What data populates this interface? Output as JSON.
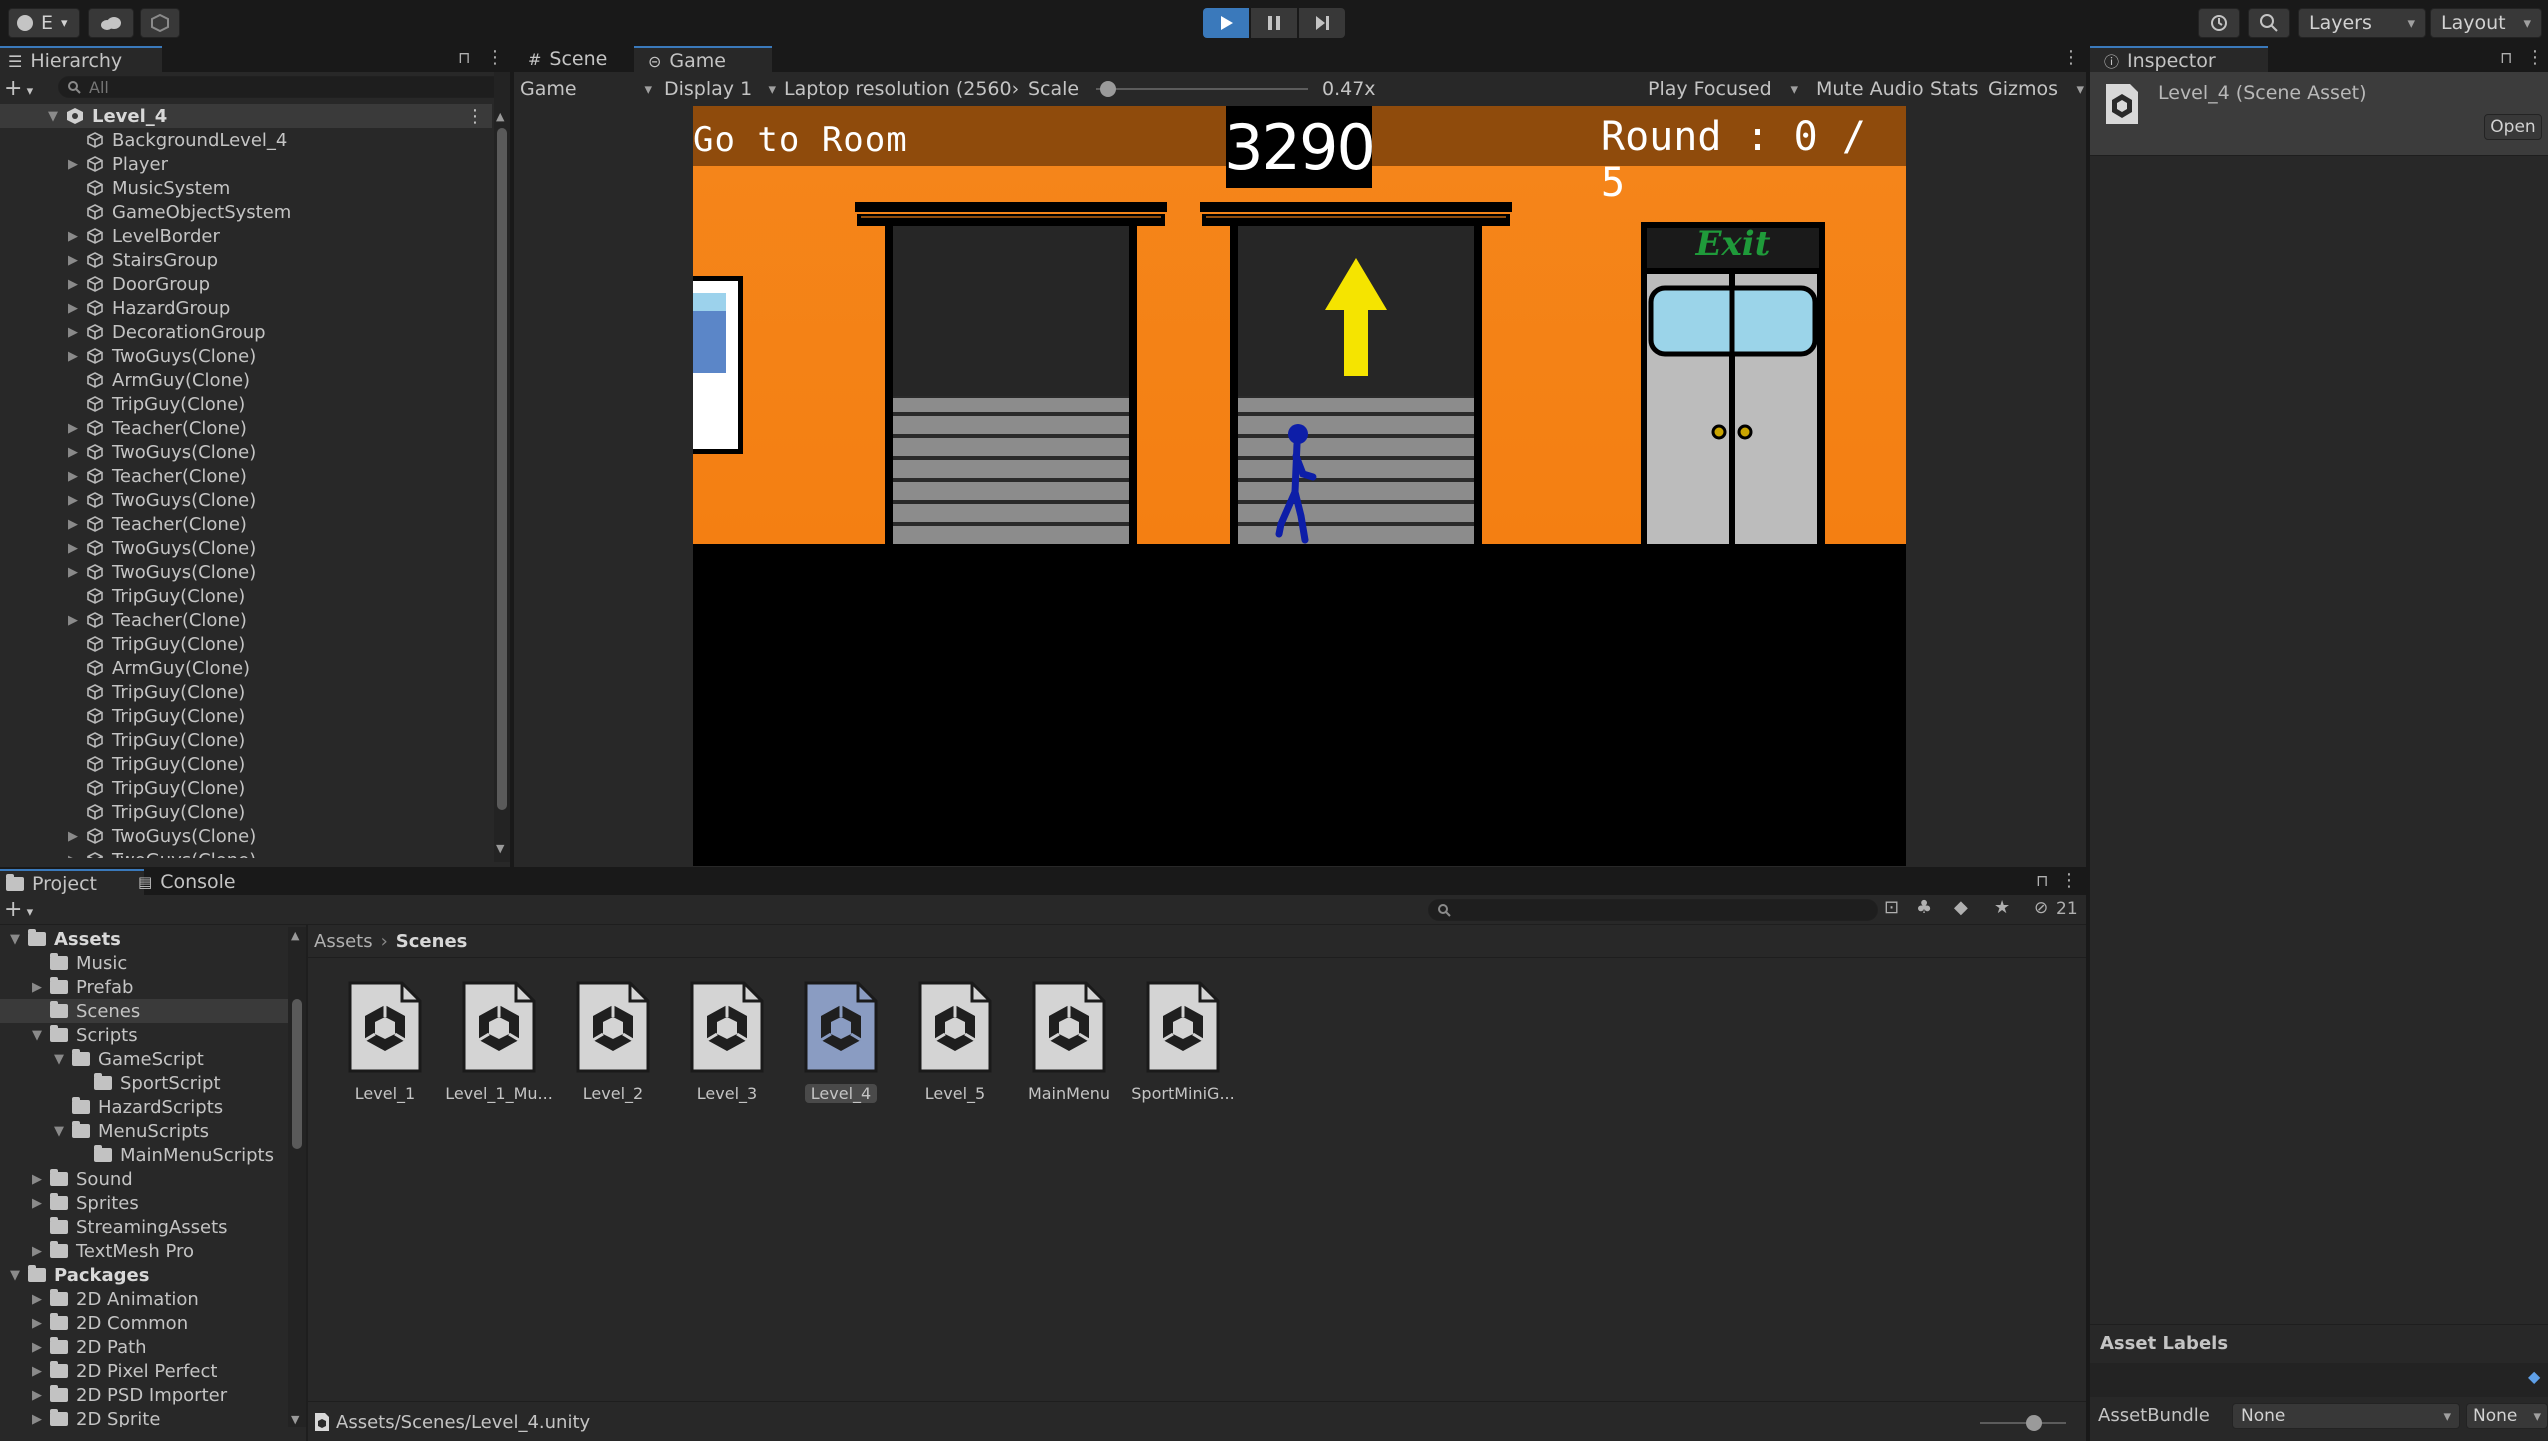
{
  "toolbar": {
    "account_label": "E",
    "layers_label": "Layers",
    "layout_label": "Layout"
  },
  "hierarchy": {
    "tab": "Hierarchy",
    "search_placeholder": "All",
    "scene_name": "Level_4",
    "items": [
      {
        "label": "BackgroundLevel_4",
        "expandable": false
      },
      {
        "label": "Player",
        "expandable": true
      },
      {
        "label": "MusicSystem",
        "expandable": false
      },
      {
        "label": "GameObjectSystem",
        "expandable": false
      },
      {
        "label": "LevelBorder",
        "expandable": true
      },
      {
        "label": "StairsGroup",
        "expandable": true
      },
      {
        "label": "DoorGroup",
        "expandable": true
      },
      {
        "label": "HazardGroup",
        "expandable": true
      },
      {
        "label": "DecorationGroup",
        "expandable": true
      },
      {
        "label": "TwoGuys(Clone)",
        "expandable": true
      },
      {
        "label": "ArmGuy(Clone)",
        "expandable": false
      },
      {
        "label": "TripGuy(Clone)",
        "expandable": false
      },
      {
        "label": "Teacher(Clone)",
        "expandable": true
      },
      {
        "label": "TwoGuys(Clone)",
        "expandable": true
      },
      {
        "label": "Teacher(Clone)",
        "expandable": true
      },
      {
        "label": "TwoGuys(Clone)",
        "expandable": true
      },
      {
        "label": "Teacher(Clone)",
        "expandable": true
      },
      {
        "label": "TwoGuys(Clone)",
        "expandable": true
      },
      {
        "label": "TwoGuys(Clone)",
        "expandable": true
      },
      {
        "label": "TripGuy(Clone)",
        "expandable": false
      },
      {
        "label": "Teacher(Clone)",
        "expandable": true
      },
      {
        "label": "TripGuy(Clone)",
        "expandable": false
      },
      {
        "label": "ArmGuy(Clone)",
        "expandable": false
      },
      {
        "label": "TripGuy(Clone)",
        "expandable": false
      },
      {
        "label": "TripGuy(Clone)",
        "expandable": false
      },
      {
        "label": "TripGuy(Clone)",
        "expandable": false
      },
      {
        "label": "TripGuy(Clone)",
        "expandable": false
      },
      {
        "label": "TripGuy(Clone)",
        "expandable": false
      },
      {
        "label": "TripGuy(Clone)",
        "expandable": false
      },
      {
        "label": "TwoGuys(Clone)",
        "expandable": true
      },
      {
        "label": "TwoGuys(Clone)",
        "expandable": true
      }
    ]
  },
  "view_tabs": {
    "scene": "Scene",
    "game": "Game"
  },
  "game_toolbar": {
    "view_mode": "Game",
    "display": "Display 1",
    "resolution": "Laptop resolution (2560›",
    "scale_label": "Scale",
    "scale_value": "0.47x",
    "scale_fraction": 0.02,
    "play_focused": "Play Focused",
    "mute_audio": "Mute Audio",
    "stats": "Stats",
    "gizmos": "Gizmos"
  },
  "game": {
    "go_to_room": "Go to Room",
    "score": "3290",
    "round": "Round : 0 / 5",
    "exit_sign": "Exit"
  },
  "inspector": {
    "tab": "Inspector",
    "asset_title": "Level_4 (Scene Asset)",
    "open_button": "Open",
    "asset_labels": "Asset Labels",
    "assetbundle_label": "AssetBundle",
    "assetbundle_value": "None",
    "variant_value": "None"
  },
  "project": {
    "tab_project": "Project",
    "tab_console": "Console",
    "hidden_count": "21",
    "breadcrumb": [
      "Assets",
      "Scenes"
    ],
    "tree": [
      {
        "label": "Assets",
        "depth": 0,
        "arrow": "open",
        "bold": true
      },
      {
        "label": "Music",
        "depth": 1,
        "arrow": "none"
      },
      {
        "label": "Prefab",
        "depth": 1,
        "arrow": "closed"
      },
      {
        "label": "Scenes",
        "depth": 1,
        "arrow": "none",
        "selected": true
      },
      {
        "label": "Scripts",
        "depth": 1,
        "arrow": "open"
      },
      {
        "label": "GameScript",
        "depth": 2,
        "arrow": "open"
      },
      {
        "label": "SportScript",
        "depth": 3,
        "arrow": "none"
      },
      {
        "label": "HazardScripts",
        "depth": 2,
        "arrow": "none"
      },
      {
        "label": "MenuScripts",
        "depth": 2,
        "arrow": "open"
      },
      {
        "label": "MainMenuScripts",
        "depth": 3,
        "arrow": "none"
      },
      {
        "label": "Sound",
        "depth": 1,
        "arrow": "closed"
      },
      {
        "label": "Sprites",
        "depth": 1,
        "arrow": "closed"
      },
      {
        "label": "StreamingAssets",
        "depth": 1,
        "arrow": "none"
      },
      {
        "label": "TextMesh Pro",
        "depth": 1,
        "arrow": "closed"
      },
      {
        "label": "Packages",
        "depth": 0,
        "arrow": "open",
        "bold": true
      },
      {
        "label": "2D Animation",
        "depth": 1,
        "arrow": "closed"
      },
      {
        "label": "2D Common",
        "depth": 1,
        "arrow": "closed"
      },
      {
        "label": "2D Path",
        "depth": 1,
        "arrow": "closed"
      },
      {
        "label": "2D Pixel Perfect",
        "depth": 1,
        "arrow": "closed"
      },
      {
        "label": "2D PSD Importer",
        "depth": 1,
        "arrow": "closed"
      },
      {
        "label": "2D Sprite",
        "depth": 1,
        "arrow": "closed"
      }
    ],
    "assets": [
      {
        "label": "Level_1"
      },
      {
        "label": "Level_1_Mu..."
      },
      {
        "label": "Level_2"
      },
      {
        "label": "Level_3"
      },
      {
        "label": "Level_4",
        "selected": true
      },
      {
        "label": "Level_5"
      },
      {
        "label": "MainMenu"
      },
      {
        "label": "SportMiniG..."
      }
    ],
    "status_path": "Assets/Scenes/Level_4.unity"
  },
  "colors": {
    "accent": "#3a79bb",
    "wall_orange": "#f5861b",
    "exit_green": "#1f9a3a",
    "player_blue": "#0d1ea8",
    "arrow_yellow": "#f5e400"
  }
}
